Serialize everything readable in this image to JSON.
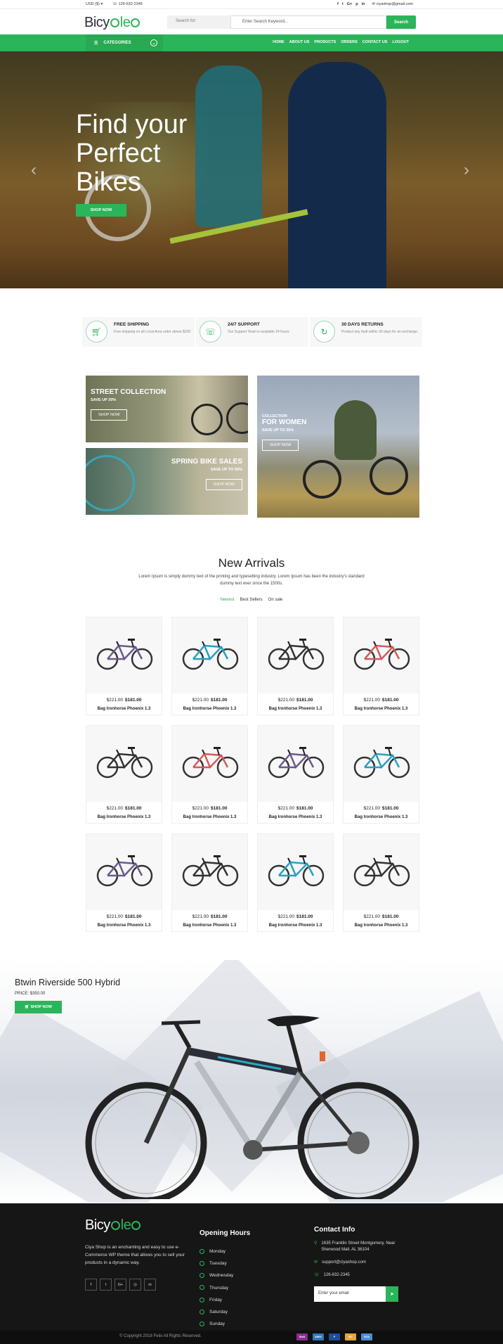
{
  "topbar": {
    "currency": "USD ($)",
    "phone": "126-632-2345",
    "social_icons": [
      "facebook-icon",
      "twitter-icon",
      "google-plus-icon",
      "pinterest-icon",
      "linkedin-icon"
    ],
    "social_glyphs": [
      "f",
      "t",
      "G+",
      "p",
      "in"
    ],
    "email": "ciyashop@gmail.com"
  },
  "header": {
    "logo_a": "Bicy",
    "logo_b": "le",
    "search_label": "Search for:",
    "search_placeholder": "Enter Search Keyword...",
    "search_button": "Search"
  },
  "nav": {
    "categories": "CATEGORIES",
    "menu": [
      "HOME",
      "ABOUT US",
      "PRODUCTS",
      "ORDERS",
      "CONTACT US",
      "LOGOUT"
    ]
  },
  "hero": {
    "line1": "Find your",
    "line2": "Perfect",
    "line3": "Bikes",
    "button": "SHOP NOW"
  },
  "features": [
    {
      "title": "FREE SHIPPING",
      "desc": "Free shipping on all Local Area order above $200"
    },
    {
      "title": "24/7 SUPPORT",
      "desc": "Our Support Team is available 24 hours"
    },
    {
      "title": "30 DAYS RETURNS",
      "desc": "Product any fault within 30 days for an exchange."
    }
  ],
  "banners": {
    "street": {
      "title": "STREET COLLECTION",
      "sub": "SAVE UP 30%",
      "button": "SHOP NOW"
    },
    "spring": {
      "title": "SPRING BIKE SALES",
      "sub": "SAVE UP TO 50%",
      "button": "SHOP NOW"
    },
    "women": {
      "pre": "COLLECTION",
      "title": "FOR WOMEN",
      "sub": "SAVE UP TO 25%",
      "button": "SHOP NOW"
    }
  },
  "arrivals": {
    "title": "New Arrivals",
    "desc": "Lorem Ipsum is simply dummy text of the printing and typesetting industry. Lorem Ipsum has been the industry's standard dummy text ever since the 1500s.",
    "tabs": [
      "Newest",
      "Best Sellers",
      "On sale"
    ],
    "products": [
      {
        "old": "$221.00",
        "new": "$181.00",
        "name": "Bag Ironhorse Phoenix 1.3",
        "color": "#6b5a8c"
      },
      {
        "old": "$221.00",
        "new": "$181.00",
        "name": "Bag Ironhorse Phoenix 1.3",
        "color": "#2a9fbf"
      },
      {
        "old": "$221.00",
        "new": "$181.00",
        "name": "Bag Ironhorse Phoenix 1.3",
        "color": "#333333"
      },
      {
        "old": "$221.00",
        "new": "$181.00",
        "name": "Bag Ironhorse Phoenix 1.3",
        "color": "#d35b5b"
      },
      {
        "old": "$221.00",
        "new": "$181.00",
        "name": "Bag Ironhorse Phoenix 1.3",
        "color": "#333333"
      },
      {
        "old": "$221.00",
        "new": "$181.00",
        "name": "Bag Ironhorse Phoenix 1.3",
        "color": "#d35b5b"
      },
      {
        "old": "$221.00",
        "new": "$181.00",
        "name": "Bag Ironhorse Phoenix 1.3",
        "color": "#6b5a8c"
      },
      {
        "old": "$221.00",
        "new": "$181.00",
        "name": "Bag Ironhorse Phoenix 1.3",
        "color": "#2a9fbf"
      },
      {
        "old": "$221.00",
        "new": "$181.00",
        "name": "Bag Ironhorse Phoenix 1.3",
        "color": "#6b5a8c"
      },
      {
        "old": "$221.00",
        "new": "$181.00",
        "name": "Bag Ironhorse Phoenix 1.3",
        "color": "#333333"
      },
      {
        "old": "$221.00",
        "new": "$181.00",
        "name": "Bag Ironhorse Phoenix 1.3",
        "color": "#2a9fbf"
      },
      {
        "old": "$221.00",
        "new": "$181.00",
        "name": "Bag Ironhorse Phoenix 1.3",
        "color": "#333333"
      }
    ]
  },
  "promo": {
    "title": "Btwin Riverside 500 Hybrid",
    "price": "PRICE: $350.00",
    "button": "SHOP NOW"
  },
  "footer": {
    "about": "Ciya Shop is an enchanting and easy to use e-Commerce WP theme that allows you to sell your products in a dynamic way.",
    "social_glyphs": [
      "f",
      "t",
      "G+",
      "◎",
      "in"
    ],
    "hours_title": "Opening Hours",
    "days": [
      "Monday",
      "Tuesday",
      "Wednesday",
      "Thursday",
      "Friday",
      "Saturday",
      "Sunday"
    ],
    "contact_title": "Contact Info",
    "address": "1635 Franklin Street Montgomery, Near Sherwood Mall. AL 36104",
    "email": "support@ciyashop.com",
    "phone": "126-632-2345",
    "email_placeholder": "Enter your email",
    "copyright": "© Copyright 2018 Felix All Rights Reserved."
  },
  "payments": [
    {
      "label": "Skrill",
      "color": "#8b2c8e"
    },
    {
      "label": "AMEX",
      "color": "#2e77bb"
    },
    {
      "label": "P",
      "color": "#1b4f9c"
    },
    {
      "label": "MC",
      "color": "#e8a33c"
    },
    {
      "label": "VISA",
      "color": "#4a8fd4"
    }
  ],
  "colors": {
    "accent": "#2bb55a",
    "footer_bg": "#161616"
  }
}
